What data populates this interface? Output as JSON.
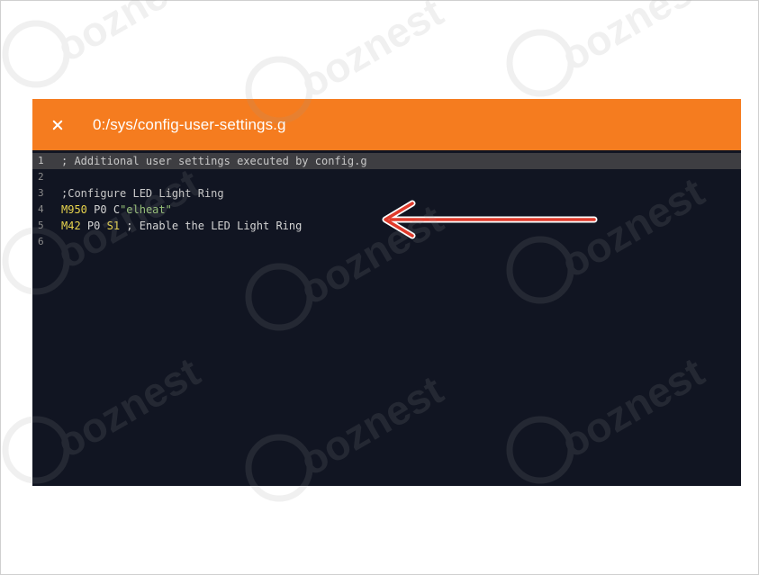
{
  "window": {
    "title": "0:/sys/config-user-settings.g",
    "close_icon": "close-icon",
    "accent_color": "#f57c1f",
    "editor_bg": "#111522"
  },
  "editor": {
    "lines": [
      {
        "num": "1",
        "text": "; Additional user settings executed by config.g"
      },
      {
        "num": "2",
        "text": ""
      },
      {
        "num": "3",
        "text": ";Configure LED Light Ring"
      },
      {
        "num": "4",
        "cmd": "M950",
        "p1": "P0",
        "p2": "C",
        "str": "\"elheat\""
      },
      {
        "num": "5",
        "cmd": "M42",
        "p1": "P0",
        "p2": "S1",
        "comment": " ; Enable the LED Light Ring"
      },
      {
        "num": "6",
        "text": ""
      }
    ]
  },
  "annotation": {
    "arrow_icon": "red-arrow-icon",
    "arrow_color": "#e03a2b"
  },
  "watermark": {
    "text": "ooznest"
  }
}
